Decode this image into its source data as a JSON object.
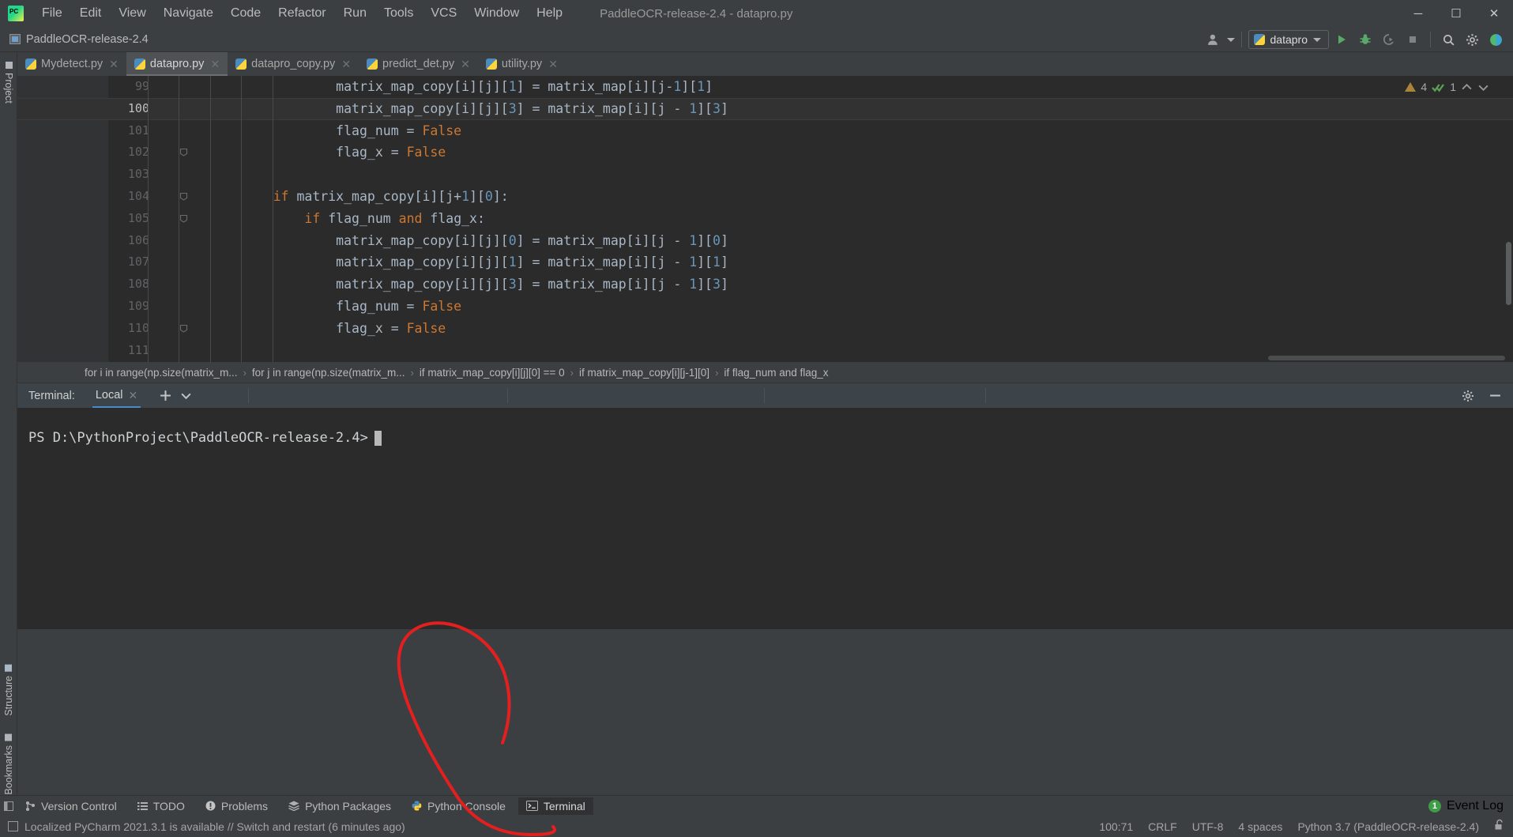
{
  "menubar": {
    "logo_icon": "pycharm-logo-icon",
    "items": [
      "File",
      "Edit",
      "View",
      "Navigate",
      "Code",
      "Refactor",
      "Run",
      "Tools",
      "VCS",
      "Window",
      "Help"
    ],
    "window_title": "PaddleOCR-release-2.4 - dataprо.py",
    "window_title_text": "PaddleOCR-release-2.4 - datapro.py",
    "controls": {
      "minimize": "─",
      "maximize": "☐",
      "close": "✕"
    }
  },
  "navbar": {
    "project_name": "PaddleOCR-release-2.4",
    "account_icon": "user-account-icon",
    "run_config": {
      "label": "datapro",
      "icon": "python-file-icon"
    },
    "actions": [
      "run-icon",
      "debug-icon",
      "run-coverage-icon",
      "stop-icon",
      "search-everywhere-icon",
      "settings-icon",
      "updates-icon"
    ]
  },
  "left_stripe": {
    "top": [
      {
        "label": "Project",
        "icon": "folder-icon"
      }
    ],
    "bottom": [
      {
        "label": "Structure",
        "icon": "structure-icon"
      },
      {
        "label": "Bookmarks",
        "icon": "bookmark-icon"
      }
    ]
  },
  "editor": {
    "tabs": [
      {
        "label": "Mydetect.py",
        "active": false
      },
      {
        "label": "datapro.py",
        "active": true
      },
      {
        "label": "datapro_copy.py",
        "active": false
      },
      {
        "label": "predict_det.py",
        "active": false
      },
      {
        "label": "utility.py",
        "active": false
      }
    ],
    "inspection": {
      "warning_count": "4",
      "ok_count": "1",
      "up_icon": "chevron-up-icon",
      "down_icon": "chevron-down-icon"
    },
    "current_line": 100,
    "lines": [
      {
        "num": "99",
        "indent": 7,
        "tokens": [
          [
            "p",
            "matrix_map_copy[i][j]["
          ],
          [
            "n",
            "1"
          ],
          [
            "p",
            "] = matrix_map[i][j-"
          ],
          [
            "n",
            "1"
          ],
          [
            "p",
            "]["
          ],
          [
            "n",
            "1"
          ],
          [
            "p",
            "]"
          ]
        ]
      },
      {
        "num": "100",
        "indent": 7,
        "tokens": [
          [
            "p",
            "matrix_map_copy[i][j]["
          ],
          [
            "n",
            "3"
          ],
          [
            "p",
            "] = matrix_map[i][j - "
          ],
          [
            "n",
            "1"
          ],
          [
            "p",
            "]["
          ],
          [
            "n",
            "3"
          ],
          [
            "p",
            "]"
          ]
        ]
      },
      {
        "num": "101",
        "indent": 7,
        "tokens": [
          [
            "p",
            "flag_num = "
          ],
          [
            "k",
            "False"
          ]
        ]
      },
      {
        "num": "102",
        "indent": 7,
        "fold": true,
        "tokens": [
          [
            "p",
            "flag_x = "
          ],
          [
            "k",
            "False"
          ]
        ]
      },
      {
        "num": "103",
        "indent": 0,
        "tokens": [
          [
            "p",
            ""
          ]
        ]
      },
      {
        "num": "104",
        "indent": 5,
        "fold": true,
        "tokens": [
          [
            "k",
            "if"
          ],
          [
            "p",
            " matrix_map_copy[i][j+"
          ],
          [
            "n",
            "1"
          ],
          [
            "p",
            "]["
          ],
          [
            "n",
            "0"
          ],
          [
            "p",
            "]:"
          ]
        ]
      },
      {
        "num": "105",
        "indent": 6,
        "fold": true,
        "tokens": [
          [
            "k",
            "if"
          ],
          [
            "p",
            " flag_num "
          ],
          [
            "k",
            "and"
          ],
          [
            "p",
            " flag_x:"
          ]
        ]
      },
      {
        "num": "106",
        "indent": 7,
        "tokens": [
          [
            "p",
            "matrix_map_copy[i][j]["
          ],
          [
            "n",
            "0"
          ],
          [
            "p",
            "] = matrix_map[i][j - "
          ],
          [
            "n",
            "1"
          ],
          [
            "p",
            "]["
          ],
          [
            "n",
            "0"
          ],
          [
            "p",
            "]"
          ]
        ]
      },
      {
        "num": "107",
        "indent": 7,
        "tokens": [
          [
            "p",
            "matrix_map_copy[i][j]["
          ],
          [
            "n",
            "1"
          ],
          [
            "p",
            "] = matrix_map[i][j - "
          ],
          [
            "n",
            "1"
          ],
          [
            "p",
            "]["
          ],
          [
            "n",
            "1"
          ],
          [
            "p",
            "]"
          ]
        ]
      },
      {
        "num": "108",
        "indent": 7,
        "tokens": [
          [
            "p",
            "matrix_map_copy[i][j]["
          ],
          [
            "n",
            "3"
          ],
          [
            "p",
            "] = matrix_map[i][j - "
          ],
          [
            "n",
            "1"
          ],
          [
            "p",
            "]["
          ],
          [
            "n",
            "3"
          ],
          [
            "p",
            "]"
          ]
        ]
      },
      {
        "num": "109",
        "indent": 7,
        "tokens": [
          [
            "p",
            "flag_num = "
          ],
          [
            "k",
            "False"
          ]
        ]
      },
      {
        "num": "110",
        "indent": 7,
        "fold": true,
        "tokens": [
          [
            "p",
            "flag_x = "
          ],
          [
            "k",
            "False"
          ]
        ]
      },
      {
        "num": "111",
        "indent": 0,
        "tokens": [
          [
            "p",
            ""
          ]
        ]
      }
    ]
  },
  "breadcrumbs": [
    "for i in range(np.size(matrix_m...",
    "for j in range(np.size(matrix_m...",
    "if matrix_map_copy[i][j][0] == 0",
    "if matrix_map_copy[i][j-1][0]",
    "if flag_num and flag_x"
  ],
  "terminal": {
    "label": "Terminal:",
    "tab": "Local",
    "add_icon": "plus-icon",
    "dropdown_icon": "chevron-down-icon",
    "settings_icon": "gear-icon",
    "minimize_icon": "minimize-icon",
    "prompt": "PS D:\\PythonProject\\PaddleOCR-release-2.4>"
  },
  "toolwindow_bar": {
    "items": [
      {
        "label": "Version Control",
        "icon": "branch-icon",
        "selected": false
      },
      {
        "label": "TODO",
        "icon": "list-icon",
        "selected": false
      },
      {
        "label": "Problems",
        "icon": "error-icon",
        "selected": false
      },
      {
        "label": "Python Packages",
        "icon": "packages-icon",
        "selected": false
      },
      {
        "label": "Python Console",
        "icon": "python-icon",
        "selected": false
      },
      {
        "label": "Terminal",
        "icon": "terminal-icon",
        "selected": true
      }
    ],
    "event_log": {
      "label": "Event Log",
      "count": "1"
    }
  },
  "statusbar": {
    "message": "Localized PyCharm 2021.3.1 is available // Switch and restart (6 minutes ago)",
    "caret_position": "100:71",
    "line_separator": "CRLF",
    "encoding": "UTF-8",
    "indent": "4 spaces",
    "interpreter": "Python 3.7 (PaddleOCR-release-2.4)",
    "lock_icon": "unlocked-icon"
  },
  "annotation": {
    "shape": "red-hand-drawn-circle",
    "color": "#e41f1f"
  },
  "colors": {
    "bg_ui": "#3c3f41",
    "bg_editor": "#2b2b2b",
    "gutter": "#313335",
    "keyword": "#cc7832",
    "number": "#6897bb",
    "text": "#a9b7c6",
    "accent_blue": "#4a88c7",
    "green_badge": "#3f9c47"
  }
}
